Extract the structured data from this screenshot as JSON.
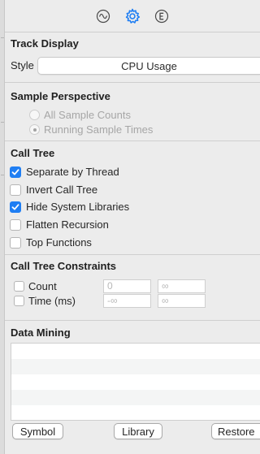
{
  "toolbar": {
    "icons": [
      "waveform-icon",
      "gear-icon",
      "extended-detail-icon"
    ],
    "accent": "#1f7ef3"
  },
  "track_display": {
    "title": "Track Display",
    "style_label": "Style",
    "style_value": "CPU Usage"
  },
  "sample_perspective": {
    "title": "Sample Perspective",
    "options": [
      {
        "label": "All Sample Counts",
        "selected": false
      },
      {
        "label": "Running Sample Times",
        "selected": true
      }
    ]
  },
  "call_tree": {
    "title": "Call Tree",
    "options": [
      {
        "label": "Separate by Thread",
        "checked": true
      },
      {
        "label": "Invert Call Tree",
        "checked": false
      },
      {
        "label": "Hide System Libraries",
        "checked": true
      },
      {
        "label": "Flatten Recursion",
        "checked": false
      },
      {
        "label": "Top Functions",
        "checked": false
      }
    ]
  },
  "constraints": {
    "title": "Call Tree Constraints",
    "rows": [
      {
        "label": "Count",
        "min": "0",
        "max": "∞"
      },
      {
        "label": "Time (ms)",
        "min": "-∞",
        "max": "∞"
      }
    ]
  },
  "data_mining": {
    "title": "Data Mining",
    "buttons": {
      "symbol": "Symbol",
      "library": "Library",
      "restore": "Restore"
    }
  }
}
